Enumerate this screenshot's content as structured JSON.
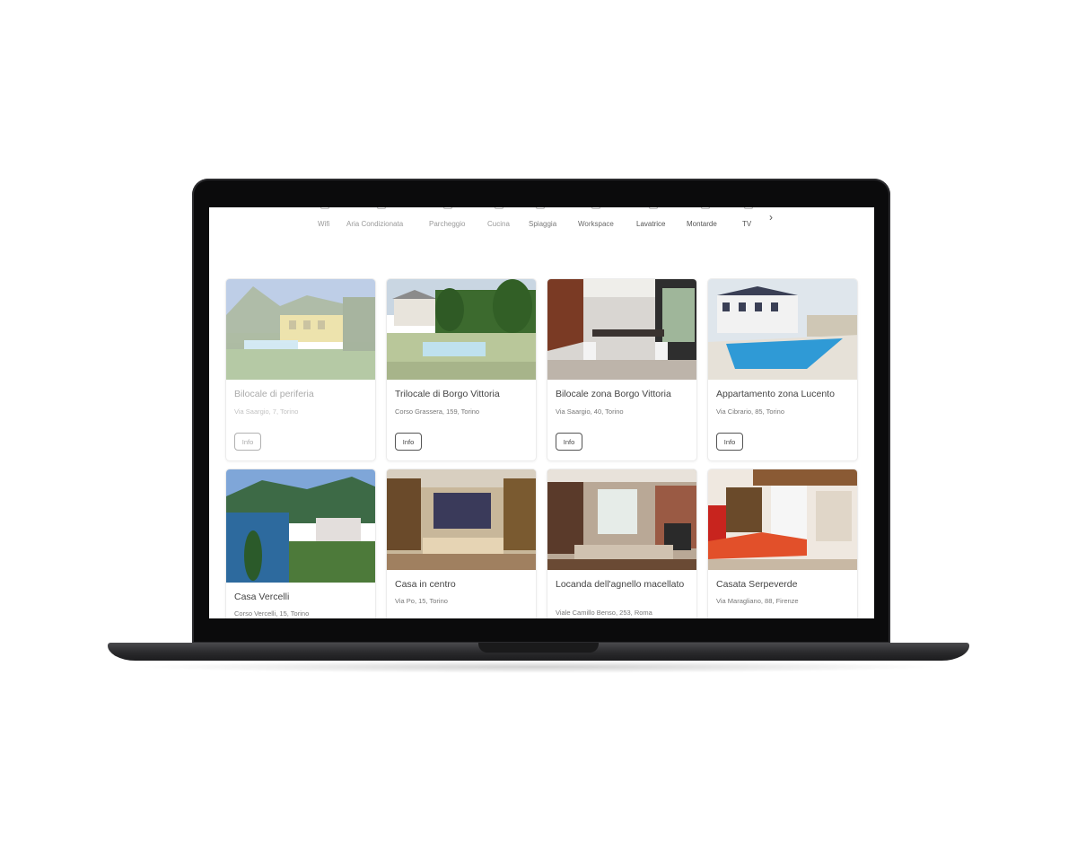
{
  "categories": {
    "items": [
      {
        "label": "Wifi",
        "emphasis": "light"
      },
      {
        "label": "Aria Condizionata",
        "emphasis": "light"
      },
      {
        "label": "Parcheggio",
        "emphasis": "light"
      },
      {
        "label": "Cucina",
        "emphasis": "light"
      },
      {
        "label": "Spiaggia",
        "emphasis": "medium"
      },
      {
        "label": "Workspace",
        "emphasis": "medium"
      },
      {
        "label": "Lavatrice",
        "emphasis": "dark"
      },
      {
        "label": "Montarde",
        "emphasis": "dark"
      },
      {
        "label": "TV",
        "emphasis": "dark"
      }
    ],
    "next_icon": "chevron-right-icon"
  },
  "listings": [
    {
      "title": "Bilocale di periferia",
      "address": "Via Saargio, 7, Torino",
      "button": "Info",
      "faded": true
    },
    {
      "title": "Trilocale di Borgo Vittoria",
      "address": "Corso Grassera, 159, Torino",
      "button": "Info"
    },
    {
      "title": "Bilocale zona Borgo Vittoria",
      "address": "Via Saargio, 40, Torino",
      "button": "Info"
    },
    {
      "title": "Appartamento zona Lucento",
      "address": "Via Cibrario, 85, Torino",
      "button": "Info"
    },
    {
      "title": "Casa Vercelli",
      "address": "Corso Vercelli, 15, Torino"
    },
    {
      "title": "Casa in centro",
      "address": "Via Po, 15, Torino"
    },
    {
      "title": "Locanda dell'agnello macellato",
      "address": "Viale Camillo Benso, 253, Roma"
    },
    {
      "title": "Casata Serpeverde",
      "address": "Via Maragliano, 88, Firenze"
    }
  ]
}
